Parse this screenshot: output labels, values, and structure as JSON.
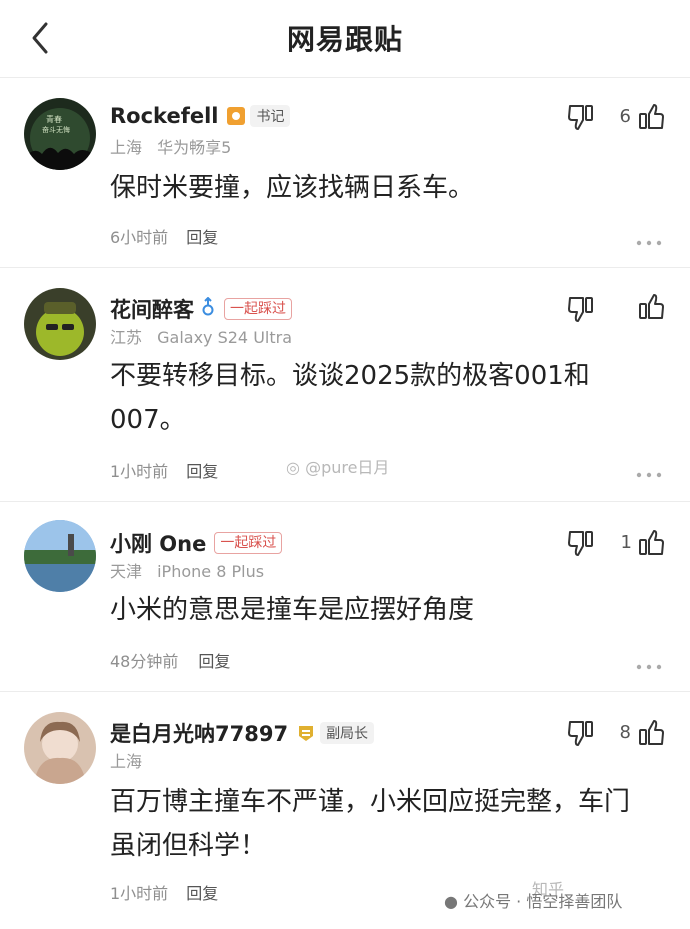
{
  "header": {
    "title": "网易跟贴"
  },
  "comments": [
    {
      "username": "Rockefell",
      "badge": "书记",
      "location": "上海",
      "device": "华为畅享5",
      "content": "保时米要撞，应该找辆日系车。",
      "time": "6小时前",
      "reply": "回复",
      "likes": "6"
    },
    {
      "username": "花间醉客",
      "badge": "一起踩过",
      "location": "江苏",
      "device": "Galaxy S24 Ultra",
      "content": "不要转移目标。谈谈2025款的极客001和007。",
      "time": "1小时前",
      "reply": "回复",
      "likes": ""
    },
    {
      "username": "小刚 One",
      "badge": "一起踩过",
      "location": "天津",
      "device": "iPhone 8 Plus",
      "content": "小米的意思是撞车是应摆好角度",
      "time": "48分钟前",
      "reply": "回复",
      "likes": "1"
    },
    {
      "username": "是白月光呐77897",
      "badge": "副局长",
      "location": "上海",
      "device": "",
      "content": "百万博主撞车不严谨，小米回应挺完整，车门虽闭但科学！",
      "time": "1小时前",
      "reply": "回复",
      "likes": "8"
    }
  ],
  "watermarks": {
    "weibo": "@pure日月",
    "footer": "公众号 · 悟空择善团队",
    "zhihu": "知乎"
  }
}
